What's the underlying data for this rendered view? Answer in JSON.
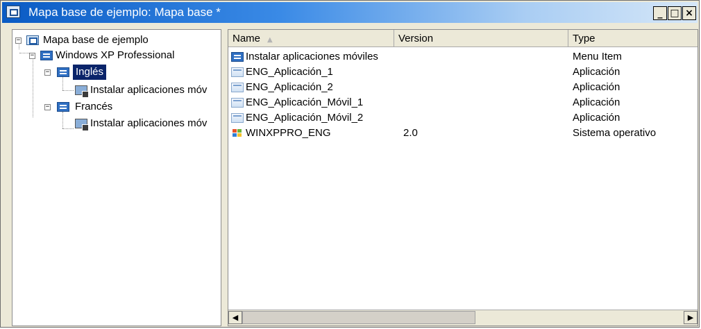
{
  "window": {
    "title": "Mapa base de ejemplo: Mapa base *",
    "controls": {
      "minimize": "_",
      "maximize": "□",
      "close": "×"
    }
  },
  "tree": {
    "root": {
      "label": "Mapa base de ejemplo",
      "icon": "basemap-icon"
    },
    "os": {
      "label": "Windows XP Professional",
      "icon": "os-icon"
    },
    "lang1": {
      "label": "Inglés",
      "icon": "language-icon",
      "selected": true
    },
    "lang1_child": {
      "label": "Instalar aplicaciones móv",
      "icon": "menu-item-icon"
    },
    "lang2": {
      "label": "Francés",
      "icon": "language-icon"
    },
    "lang2_child": {
      "label": "Instalar aplicaciones móv",
      "icon": "menu-item-icon"
    }
  },
  "list": {
    "columns": [
      "Name",
      "Version",
      "Type"
    ],
    "rows": [
      {
        "name": "Instalar aplicaciones móviles",
        "version": "",
        "type": "Menu Item",
        "icon": "menu-item-icon"
      },
      {
        "name": "ENG_Aplicación_1",
        "version": "",
        "type": "Aplicación",
        "icon": "application-icon"
      },
      {
        "name": "ENG_Aplicación_2",
        "version": "",
        "type": "Aplicación",
        "icon": "application-icon"
      },
      {
        "name": "ENG_Aplicación_Móvil_1",
        "version": "",
        "type": "Aplicación",
        "icon": "application-icon"
      },
      {
        "name": "ENG_Aplicación_Móvil_2",
        "version": "",
        "type": "Aplicación",
        "icon": "application-icon"
      },
      {
        "name": "WINXPPRO_ENG",
        "version": "2.0",
        "type": "Sistema operativo",
        "icon": "windows-logo-icon"
      }
    ]
  },
  "scrollbar": {
    "left": "◀",
    "right": "▶"
  },
  "colors": {
    "selection": "#0a246a",
    "titlebar_start": "#0a5bc4"
  }
}
